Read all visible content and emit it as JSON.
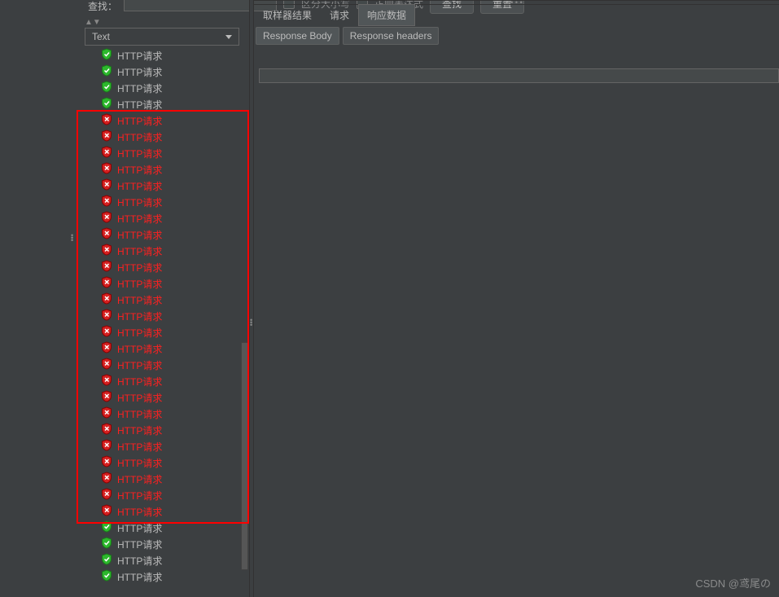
{
  "toolbar": {
    "search_label": "查找：",
    "search_value": "",
    "cb1_label": "区分大小写",
    "cb2_label": "正则表达式",
    "btn_find": "查找",
    "btn_reset": "重置"
  },
  "dropdown": {
    "value": "Text"
  },
  "tabs": {
    "t1": "取样器结果",
    "t2": "请求",
    "t3": "响应数据"
  },
  "subtabs": {
    "s1": "Response Body",
    "s2": "Response headers"
  },
  "tree": {
    "ok_label": "HTTP请求",
    "err_label": "HTTP请求",
    "items": [
      {
        "status": "ok"
      },
      {
        "status": "ok"
      },
      {
        "status": "ok"
      },
      {
        "status": "ok"
      },
      {
        "status": "err"
      },
      {
        "status": "err"
      },
      {
        "status": "err"
      },
      {
        "status": "err"
      },
      {
        "status": "err"
      },
      {
        "status": "err"
      },
      {
        "status": "err"
      },
      {
        "status": "err"
      },
      {
        "status": "err"
      },
      {
        "status": "err"
      },
      {
        "status": "err"
      },
      {
        "status": "err"
      },
      {
        "status": "err"
      },
      {
        "status": "err"
      },
      {
        "status": "err"
      },
      {
        "status": "err"
      },
      {
        "status": "err"
      },
      {
        "status": "err"
      },
      {
        "status": "err"
      },
      {
        "status": "err"
      },
      {
        "status": "err"
      },
      {
        "status": "err"
      },
      {
        "status": "err"
      },
      {
        "status": "err"
      },
      {
        "status": "err"
      },
      {
        "status": "ok"
      },
      {
        "status": "ok"
      },
      {
        "status": "ok"
      },
      {
        "status": "ok"
      }
    ]
  },
  "watermark": "CSDN @鸢尾の"
}
